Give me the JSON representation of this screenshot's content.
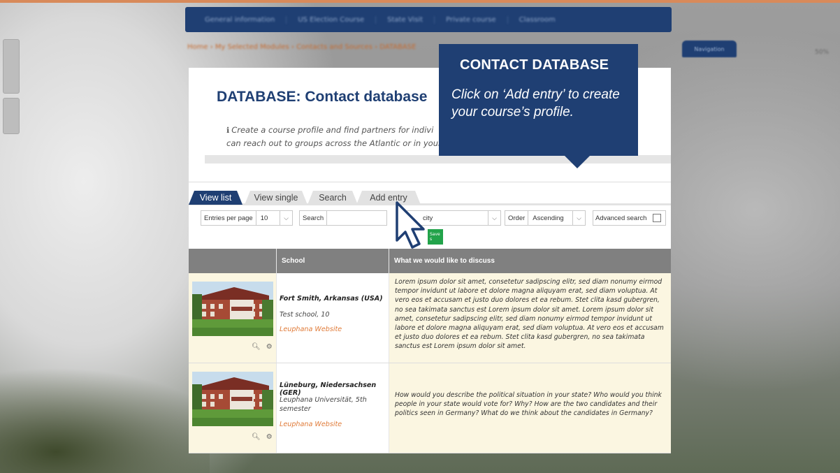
{
  "background": {
    "top_nav": [
      "General information",
      "US Election Course",
      "State Visit",
      "Private course",
      "Classroom"
    ],
    "breadcrumb": "Home › My Selected Modules › Contacts and Sources › DATABASE",
    "right_button": "Navigation",
    "right_mini": "50%"
  },
  "page": {
    "title": "DATABASE: Contact database",
    "intro_icon": "info-circle-icon",
    "intro_line1": "Create a course profile and find partners for indivi",
    "intro_line2": "can reach out to groups across the Atlantic or in your"
  },
  "tabs": [
    {
      "label": "View list",
      "active": true
    },
    {
      "label": "View single",
      "active": false
    },
    {
      "label": "Search",
      "active": false
    },
    {
      "label": "Add entry",
      "active": false
    }
  ],
  "filters": {
    "entries_label": "Entries per page",
    "entries_value": "10",
    "search_label": "Search",
    "search_value": "",
    "sort_value": "city",
    "order_label": "Order",
    "order_value": "Ascending",
    "advanced_label": "Advanced search",
    "save_label": "Save s"
  },
  "table": {
    "headers": [
      "",
      "School",
      "What we would like to discuss"
    ],
    "rows": [
      {
        "school_name": "Fort Smith, Arkansas (USA)",
        "school_detail": "Test school, 10",
        "link": "Leuphana Website",
        "discuss": "Lorem ipsum dolor sit amet, consetetur sadipscing elitr, sed diam nonumy eirmod tempor invidunt ut labore et dolore magna aliquyam erat, sed diam voluptua. At vero eos et accusam et justo duo dolores et ea rebum. Stet clita kasd gubergren, no sea takimata sanctus est Lorem ipsum dolor sit amet. Lorem ipsum dolor sit amet, consetetur sadipscing elitr, sed diam nonumy eirmod tempor invidunt ut labore et dolore magna aliquyam erat, sed diam voluptua. At vero eos et accusam et justo duo dolores et ea rebum. Stet clita kasd gubergren, no sea takimata sanctus est Lorem ipsum dolor sit amet."
      },
      {
        "school_name": "Lüneburg, Niedersachsen (GER)",
        "school_detail": "Leuphana Universität, 5th semester",
        "link": "Leuphana Website",
        "discuss": "How would you describe the political situation in your state? Who would you think people in your state would vote for? Why? How are the two candidates and their politics seen in Germany? What do we think about the candidates in Germany?"
      }
    ]
  },
  "callout": {
    "title": "CONTACT DATABASE",
    "text": "Click on ‘Add entry’ to create your course’s profile."
  },
  "colors": {
    "brand_navy": "#1f3f73",
    "accent_orange": "#e07b39",
    "save_green": "#22a34a",
    "row_cream": "#fbf6e1"
  }
}
